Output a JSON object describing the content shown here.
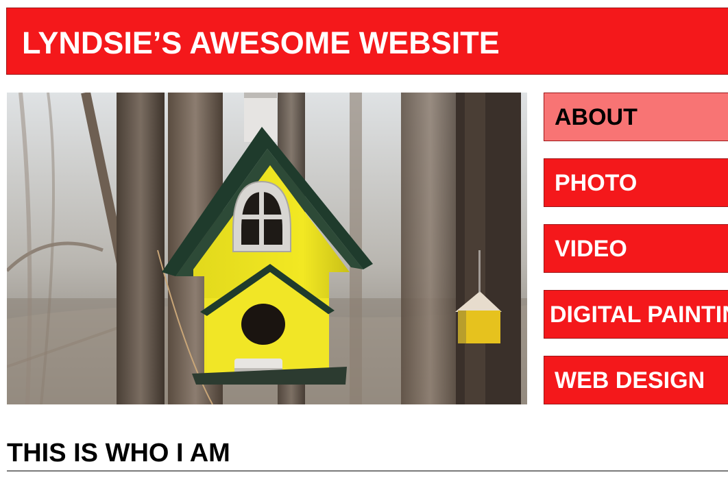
{
  "header": {
    "title": "LYNDSIE’S AWESOME WEBSITE"
  },
  "hero": {
    "subject": "yellow birdhouse hanging on a tree"
  },
  "nav": {
    "items": [
      {
        "label": "ABOUT",
        "active": true
      },
      {
        "label": "PHOTO",
        "active": false
      },
      {
        "label": "VIDEO",
        "active": false
      },
      {
        "label": "DIGITAL PAINTING",
        "active": false
      },
      {
        "label": "WEB DESIGN",
        "active": false
      }
    ]
  },
  "main": {
    "section_title": "THIS IS WHO I AM"
  },
  "colors": {
    "brand_red": "#f4181b",
    "active_nav": "#f87474",
    "text_white": "#ffffff",
    "text_black": "#000000"
  }
}
